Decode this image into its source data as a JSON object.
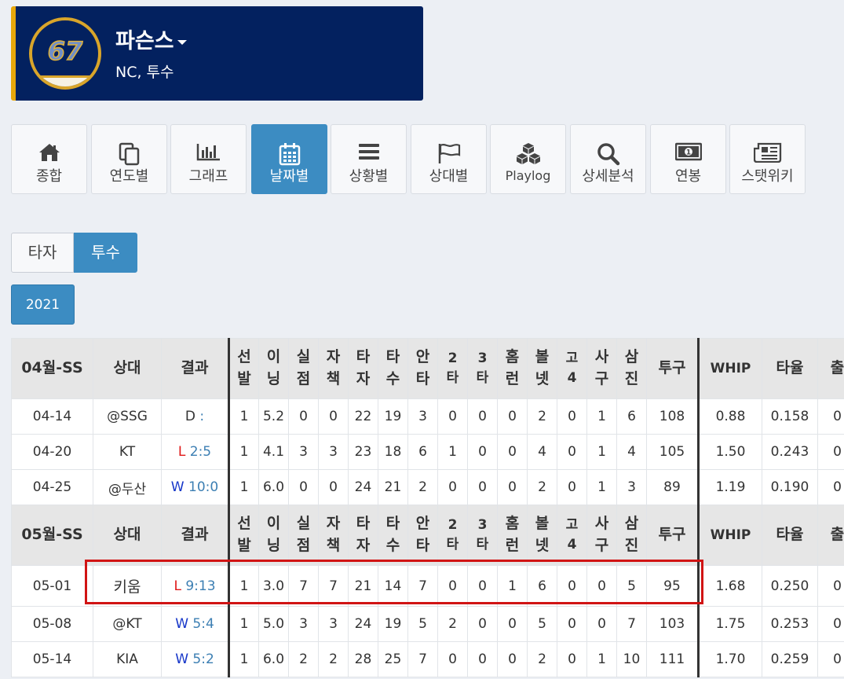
{
  "player": {
    "number": "67",
    "name": "파슨스",
    "subtitle": "NC, 투수"
  },
  "nav": [
    {
      "label": "종합",
      "icon": "home-icon"
    },
    {
      "label": "연도별",
      "icon": "copy-icon"
    },
    {
      "label": "그래프",
      "icon": "bar-chart-icon"
    },
    {
      "label": "날짜별",
      "icon": "calendar-icon",
      "active": true
    },
    {
      "label": "상황별",
      "icon": "list-icon"
    },
    {
      "label": "상대별",
      "icon": "flag-icon"
    },
    {
      "label": "Playlog",
      "icon": "cubes-icon"
    },
    {
      "label": "상세분석",
      "icon": "search-icon"
    },
    {
      "label": "연봉",
      "icon": "money-icon"
    },
    {
      "label": "스탯위키",
      "icon": "newspaper-icon"
    }
  ],
  "toggle": {
    "batter": "타자",
    "pitcher": "투수"
  },
  "year": "2021",
  "table": {
    "cols": [
      "상대",
      "결과",
      "선\n발",
      "이\n닝",
      "실\n점",
      "자\n책",
      "타\n자",
      "타\n수",
      "안\n타",
      "2\n타",
      "3\n타",
      "홈\n런",
      "볼\n넷",
      "고\n4",
      "사\n구",
      "삼\n진",
      "투구",
      "WHIP",
      "타율",
      "출"
    ],
    "months": [
      {
        "title": "04월-SS",
        "rows": [
          {
            "date": "04-14",
            "opp": "@SSG",
            "res": "D",
            "score": ":",
            "vals": [
              "1",
              "5.2",
              "0",
              "0",
              "22",
              "19",
              "3",
              "0",
              "0",
              "0",
              "2",
              "0",
              "1",
              "6",
              "108",
              "0.88",
              "0.158",
              "0"
            ]
          },
          {
            "date": "04-20",
            "opp": "KT",
            "res": "L",
            "score": "2:5",
            "vals": [
              "1",
              "4.1",
              "3",
              "3",
              "23",
              "18",
              "6",
              "1",
              "0",
              "0",
              "4",
              "0",
              "1",
              "4",
              "105",
              "1.50",
              "0.243",
              "0"
            ]
          },
          {
            "date": "04-25",
            "opp": "@두산",
            "res": "W",
            "score": "10:0",
            "vals": [
              "1",
              "6.0",
              "0",
              "0",
              "24",
              "21",
              "2",
              "0",
              "0",
              "0",
              "2",
              "0",
              "1",
              "3",
              "89",
              "1.19",
              "0.190",
              "0"
            ]
          }
        ]
      },
      {
        "title": "05월-SS",
        "rows": [
          {
            "date": "05-01",
            "opp": "키움",
            "res": "L",
            "score": "9:13",
            "highlight": true,
            "vals": [
              "1",
              "3.0",
              "7",
              "7",
              "21",
              "14",
              "7",
              "0",
              "0",
              "1",
              "6",
              "0",
              "0",
              "5",
              "95",
              "1.68",
              "0.250",
              "0"
            ]
          },
          {
            "date": "05-08",
            "opp": "@KT",
            "res": "W",
            "score": "5:4",
            "vals": [
              "1",
              "5.0",
              "3",
              "3",
              "24",
              "19",
              "5",
              "2",
              "0",
              "0",
              "5",
              "0",
              "0",
              "7",
              "103",
              "1.75",
              "0.253",
              "0"
            ]
          },
          {
            "date": "05-14",
            "opp": "KIA",
            "res": "W",
            "score": "5:2",
            "vals": [
              "1",
              "6.0",
              "2",
              "2",
              "28",
              "25",
              "7",
              "0",
              "0",
              "0",
              "2",
              "0",
              "1",
              "10",
              "111",
              "1.70",
              "0.259",
              "0"
            ]
          }
        ]
      }
    ]
  }
}
